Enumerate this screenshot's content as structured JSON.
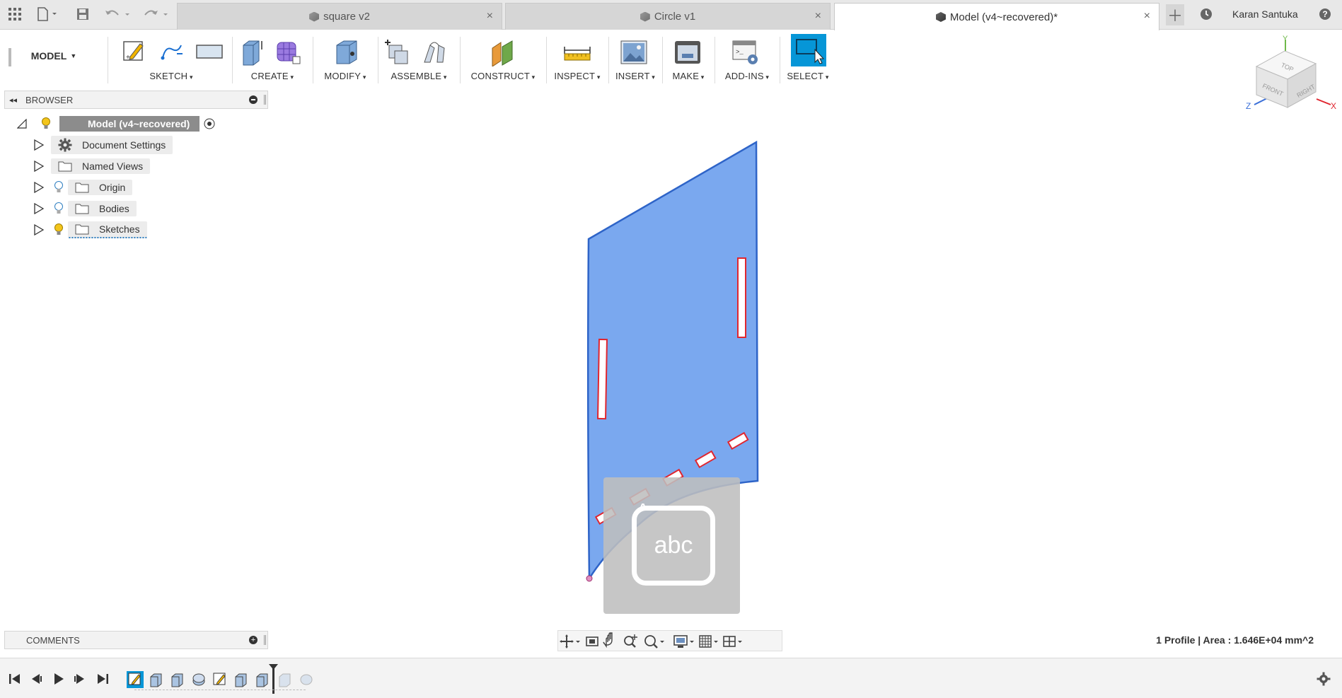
{
  "tabs": [
    {
      "label": "square v2",
      "close": "×"
    },
    {
      "label": "Circle v1",
      "close": "×"
    },
    {
      "label": "Model (v4~recovered)*",
      "close": "×"
    }
  ],
  "user": {
    "name": "Karan Santuka"
  },
  "toolbar": {
    "mode": "MODEL",
    "groups": {
      "sketch": "SKETCH",
      "create": "CREATE",
      "modify": "MODIFY",
      "assemble": "ASSEMBLE",
      "construct": "CONSTRUCT",
      "inspect": "INSPECT",
      "insert": "INSERT",
      "make": "MAKE",
      "addins": "ADD-INS",
      "select": "SELECT"
    }
  },
  "browser": {
    "title": "BROWSER",
    "root": "Model (v4~recovered)",
    "items": [
      {
        "label": "Document Settings"
      },
      {
        "label": "Named Views"
      },
      {
        "label": "Origin"
      },
      {
        "label": "Bodies"
      },
      {
        "label": "Sketches"
      }
    ]
  },
  "comments": {
    "title": "COMMENTS"
  },
  "viewcube": {
    "top": "TOP",
    "front": "FRONT",
    "right": "RIGHT",
    "x": "X",
    "y": "Y",
    "z": "Z"
  },
  "overlay": {
    "text": "abc"
  },
  "status": {
    "text": "1 Profile | Area : 1.646E+04 mm^2"
  },
  "colors": {
    "accent": "#0696d7",
    "profile_fill": "#7aa8ef",
    "profile_edge": "#2e64c8",
    "slot_edge": "#e0262f"
  }
}
